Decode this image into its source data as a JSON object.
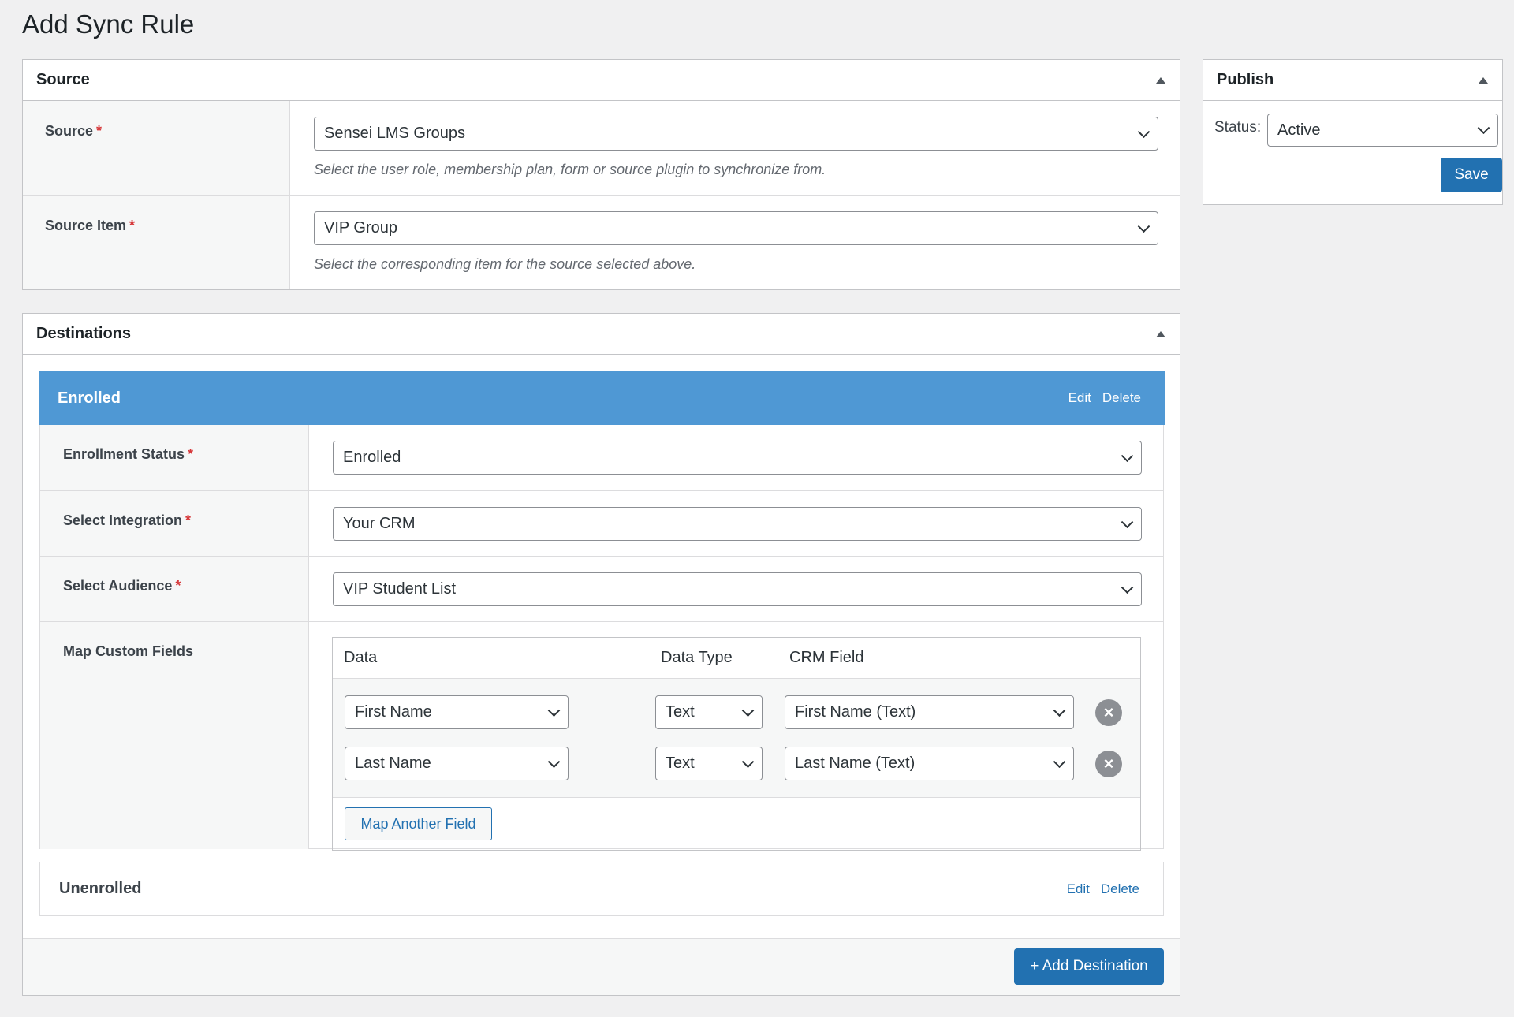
{
  "page": {
    "title": "Add Sync Rule"
  },
  "source_box": {
    "title": "Source",
    "rows": [
      {
        "label": "Source",
        "required": "*",
        "value": "Sensei LMS Groups",
        "description": "Select the user role, membership plan, form or source plugin to synchronize from."
      },
      {
        "label": "Source Item",
        "required": "*",
        "value": "VIP Group",
        "description": "Select the corresponding item for the source selected above."
      }
    ]
  },
  "publish_box": {
    "title": "Publish",
    "status_label": "Status:",
    "status_value": "Active",
    "save_label": "Save"
  },
  "destinations_box": {
    "title": "Destinations",
    "items": [
      {
        "title": "Enrolled",
        "edit_label": "Edit",
        "delete_label": "Delete",
        "fields": [
          {
            "label": "Enrollment Status",
            "required": "*",
            "value": "Enrolled"
          },
          {
            "label": "Select Integration",
            "required": "*",
            "value": "Your CRM"
          },
          {
            "label": "Select Audience",
            "required": "*",
            "value": "VIP Student List"
          }
        ],
        "map_custom_fields": {
          "label": "Map Custom Fields",
          "columns": [
            "Data",
            "Data Type",
            "CRM Field"
          ],
          "rows": [
            {
              "data": "First Name",
              "data_type": "Text",
              "crm_field": "First Name (Text)"
            },
            {
              "data": "Last Name",
              "data_type": "Text",
              "crm_field": "Last Name (Text)"
            }
          ],
          "add_label": "Map Another Field"
        }
      },
      {
        "title": "Unenrolled",
        "edit_label": "Edit",
        "delete_label": "Delete"
      }
    ],
    "add_destination_label": "+ Add Destination"
  },
  "colors": {
    "accent": "#2271b1",
    "header_blue": "#4f98d4",
    "required": "#d63638"
  }
}
